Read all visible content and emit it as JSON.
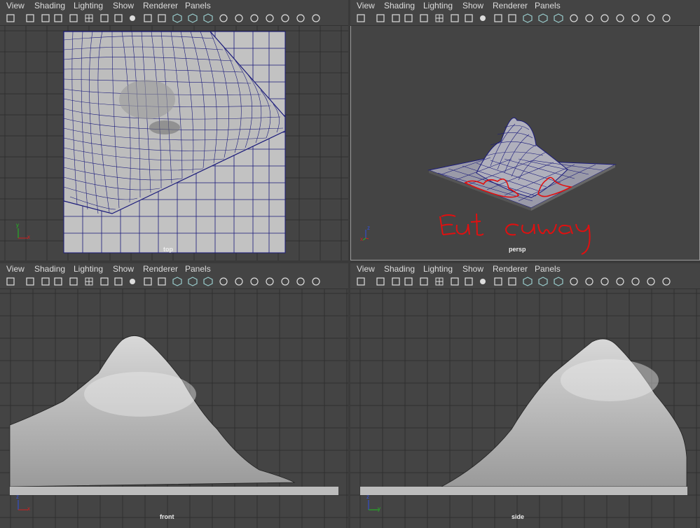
{
  "menu": [
    "View",
    "Shading",
    "Lighting",
    "Show",
    "Renderer",
    "Panels"
  ],
  "toolbar_icons": [
    "camera-select-icon",
    "camera-attributes-icon",
    "bookmark-icon",
    "image-plane-icon",
    "pencil-icon",
    "grid-icon",
    "film-gate-icon",
    "resolution-gate-icon",
    "gate-mask-icon",
    "field-chart-icon",
    "safe-action-icon",
    "wireframe-icon",
    "smooth-shade-icon",
    "wireframe-on-shaded-icon",
    "textured-icon",
    "use-all-lights-icon",
    "shadows-icon",
    "ambient-occlusion-icon",
    "motion-blur-icon",
    "anti-aliasing-icon",
    "depth-of-field-icon"
  ],
  "panels": {
    "top": {
      "camera": "top",
      "axis_v": "y",
      "axis_h": "x"
    },
    "persp": {
      "camera": "persp",
      "axis_v": "z",
      "axis_h": "x",
      "annotation": "cut away"
    },
    "front": {
      "camera": "front",
      "axis_v": "z",
      "axis_h": "x"
    },
    "side": {
      "camera": "side",
      "axis_v": "z",
      "axis_h": "y"
    }
  },
  "colors": {
    "background": "#444444",
    "grid": "#2f2f2f",
    "wire": "#1a1a7a",
    "annotation": "#e01010",
    "axis_x": "#d02020",
    "axis_y": "#20c020",
    "axis_z": "#3050e0"
  }
}
